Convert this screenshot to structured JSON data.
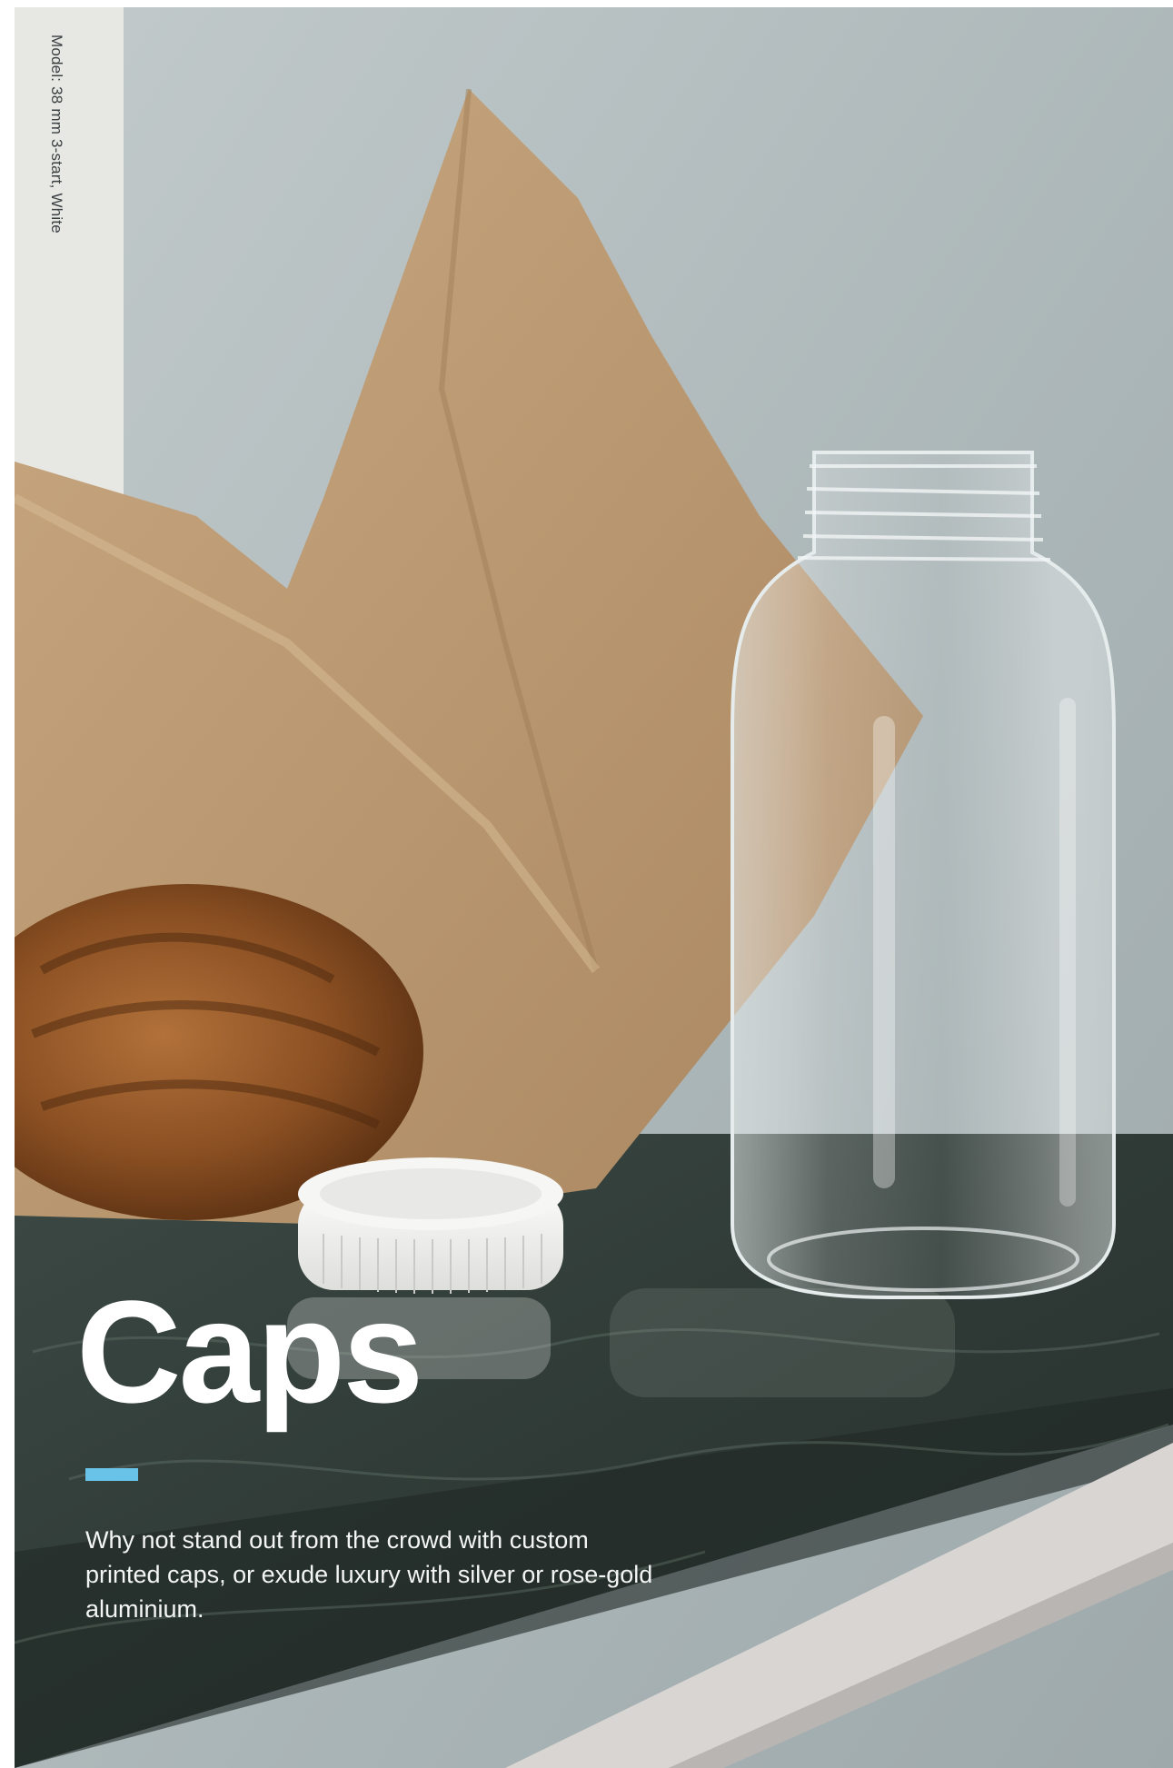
{
  "page": {
    "caption": "Model: 38 mm 3-start, White",
    "title": "Caps",
    "body": "Why not stand out from the crowd with custom printed caps, or exude luxury with silver or rose-gold aluminium."
  },
  "colors": {
    "accent": "#69c2e8",
    "title": "#ffffff",
    "backdrop": "#a9b4b6"
  }
}
